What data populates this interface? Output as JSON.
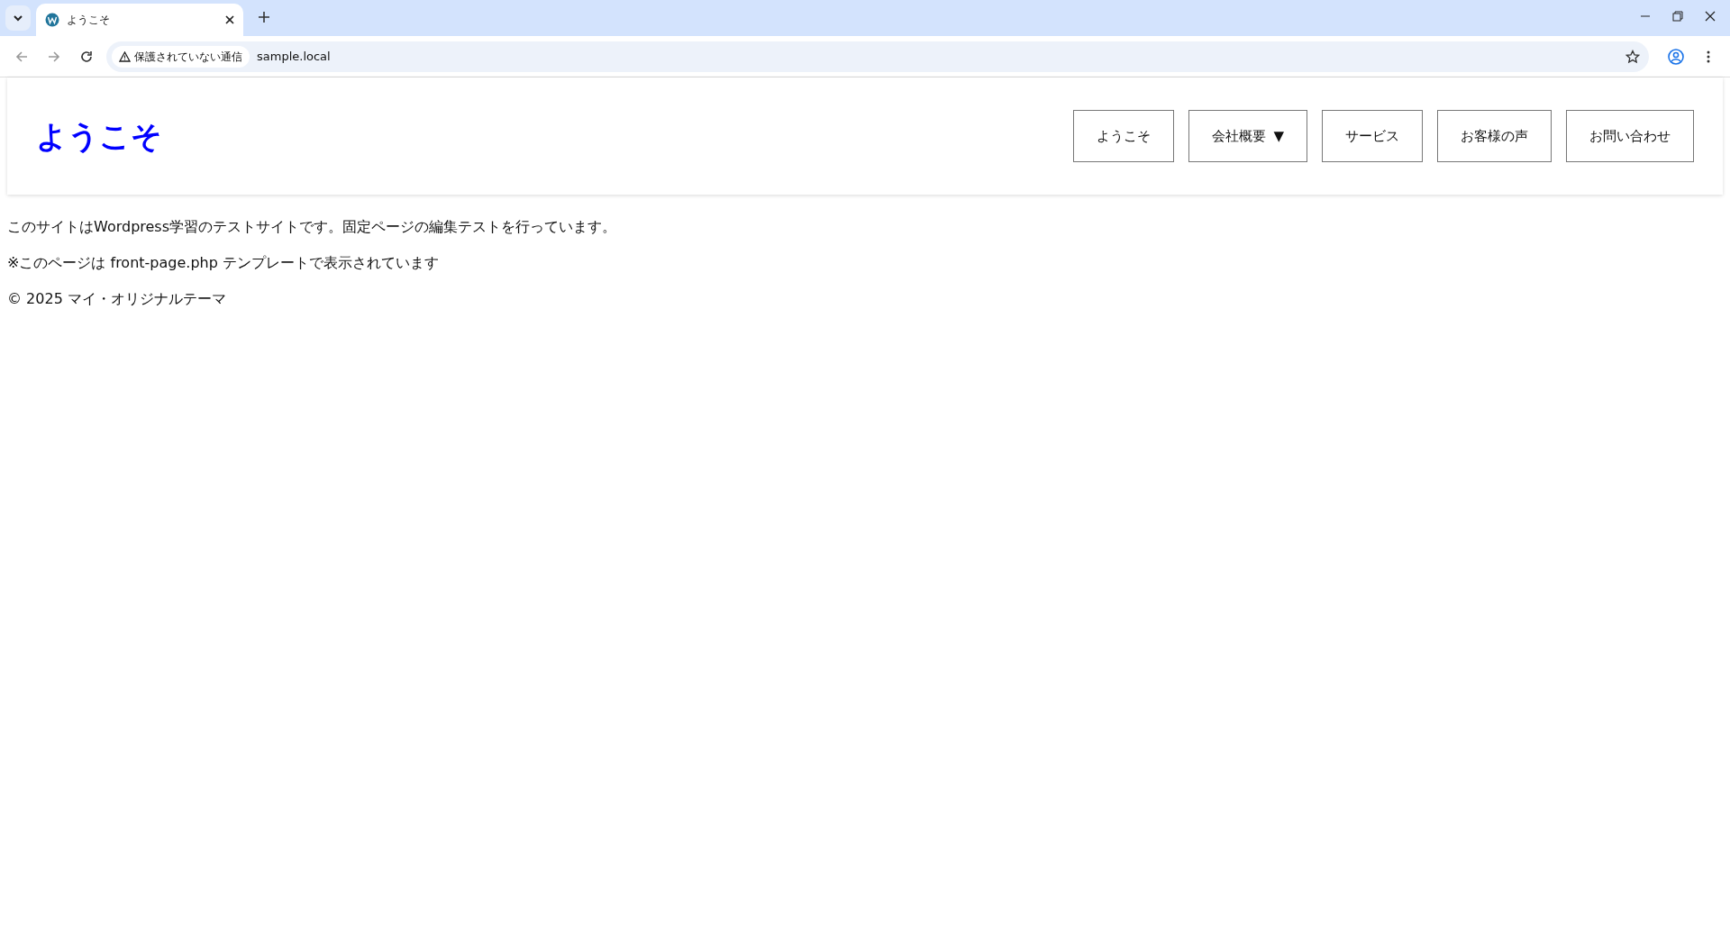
{
  "browser": {
    "tab_title": "ようこそ",
    "security_label": "保護されていない通信",
    "url": "sample.local"
  },
  "header": {
    "site_title": "ようこそ",
    "nav": [
      {
        "label": "ようこそ"
      },
      {
        "label": "会社概要",
        "caret": "▼"
      },
      {
        "label": "サービス"
      },
      {
        "label": "お客様の声"
      },
      {
        "label": "お問い合わせ"
      }
    ]
  },
  "content": [
    "このサイトはWordpress学習のテストサイトです。固定ページの編集テストを行っています。",
    "※このページは front-page.php テンプレートで表示されています"
  ],
  "footer": "© 2025 マイ・オリジナルテーマ"
}
